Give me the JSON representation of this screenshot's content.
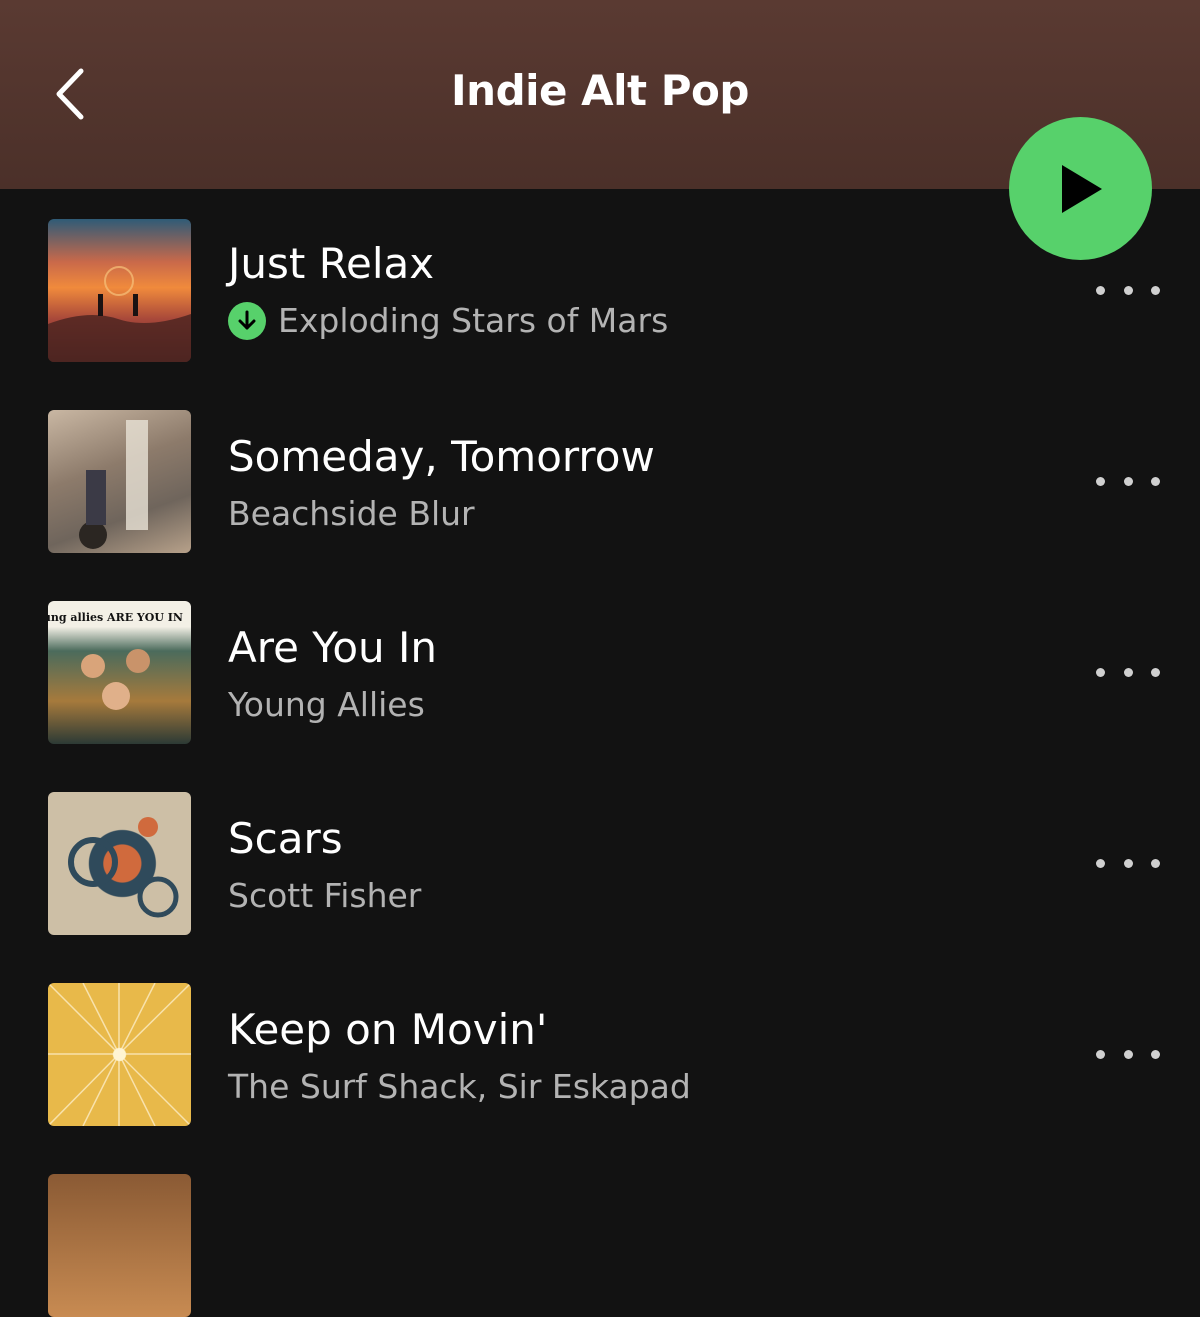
{
  "header": {
    "title": "Indie Alt Pop",
    "background": "#5a3a32"
  },
  "accent_color": "#57d16b",
  "tracks": [
    {
      "title": "Just Relax",
      "artist": "Exploding Stars of Mars",
      "downloaded": true
    },
    {
      "title": "Someday, Tomorrow",
      "artist": "Beachside Blur",
      "downloaded": false
    },
    {
      "title": "Are You In",
      "artist": "Young Allies",
      "downloaded": false,
      "art_text": "young allies ARE YOU IN"
    },
    {
      "title": "Scars",
      "artist": "Scott Fisher",
      "downloaded": false
    },
    {
      "title": "Keep on Movin'",
      "artist": "The Surf Shack, Sir Eskapad",
      "downloaded": false
    }
  ]
}
